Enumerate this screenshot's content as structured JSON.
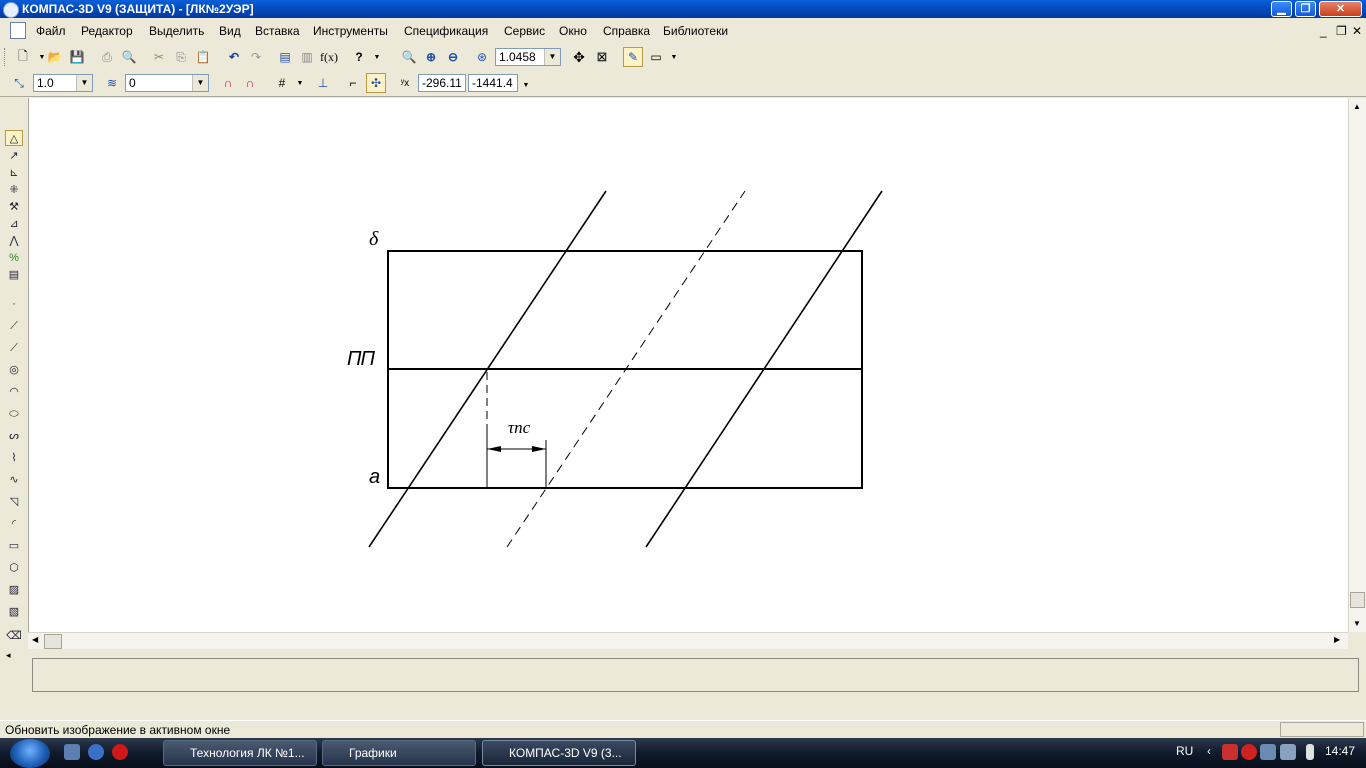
{
  "window": {
    "title": "КОМПАС-3D V9 (ЗАЩИТА) - [ЛК№2УЭР]",
    "min_glyph": "▁",
    "max_glyph": "❐",
    "close_glyph": "✕"
  },
  "menu": [
    "Файл",
    "Редактор",
    "Выделить",
    "Вид",
    "Вставка",
    "Инструменты",
    "Спецификация",
    "Сервис",
    "Окно",
    "Справка",
    "Библиотеки"
  ],
  "doc_controls": [
    "_",
    "❐",
    "✕"
  ],
  "toolbar1": {
    "zoom_value": "1.0458"
  },
  "toolbar2": {
    "step_value": "1.0",
    "layer_value": "0",
    "coord_x": "-296.11",
    "coord_y": "-1441.4"
  },
  "drawing": {
    "label_top": "δ",
    "label_mid": "ПП",
    "label_bottom": "а",
    "dimension_label": "τпс"
  },
  "status": {
    "text": "Обновить изображение в активном окне"
  },
  "taskbar": {
    "items": [
      "Технология ЛК №1...",
      "Графики",
      "КОМПАС-3D V9 (3..."
    ],
    "lang": "RU",
    "clock": "14:47"
  },
  "colors": {
    "titlebar": "#0a5fd8",
    "chrome": "#ece9d8",
    "canvas": "#ffffff"
  }
}
